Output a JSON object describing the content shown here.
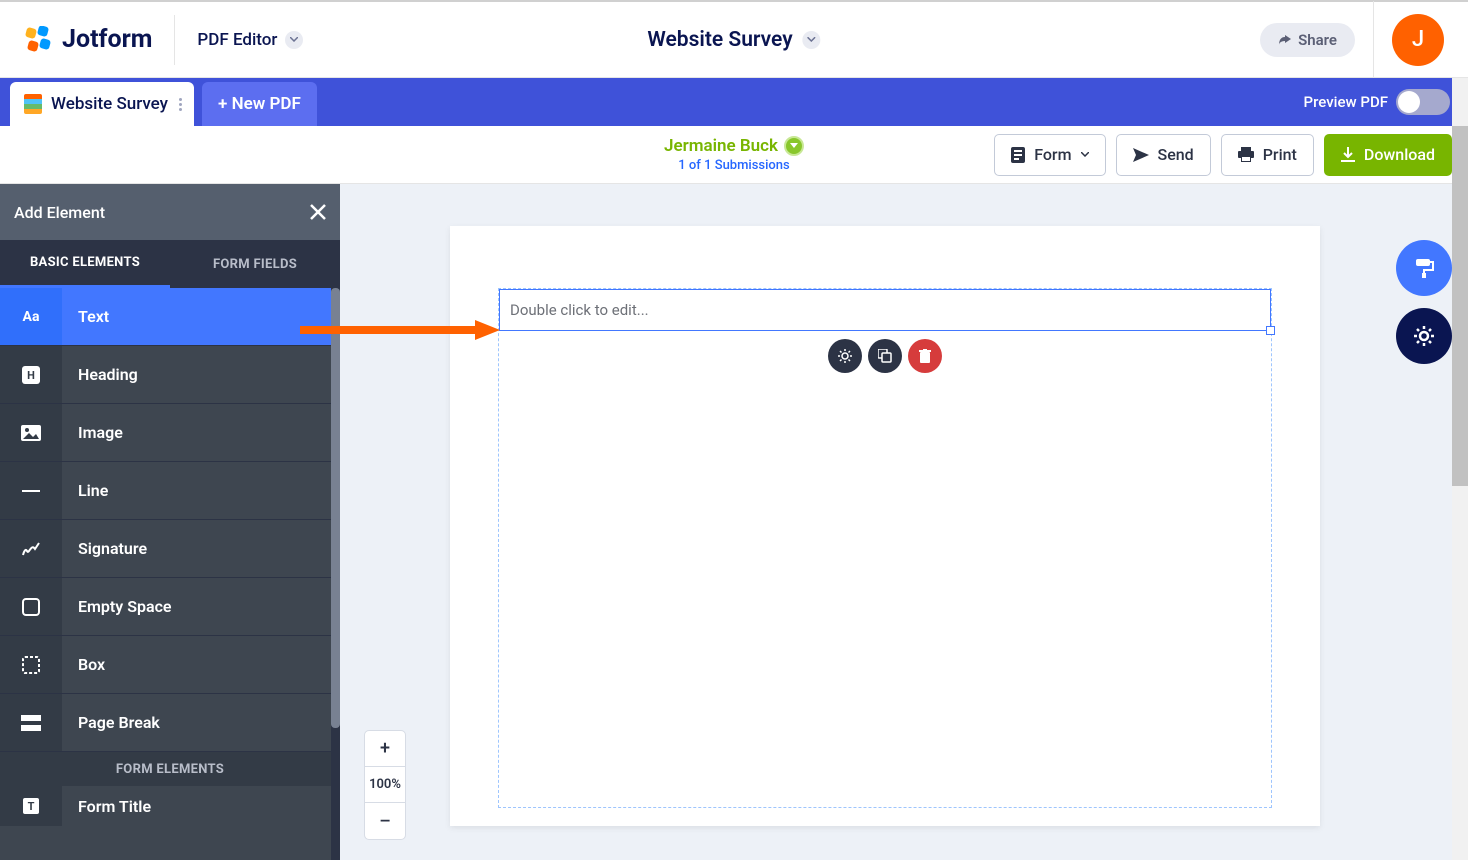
{
  "header": {
    "brand": "Jotform",
    "editor_label": "PDF Editor",
    "title": "Website Survey",
    "share": "Share",
    "avatar_initial": "J"
  },
  "tabbar": {
    "tab_label": "Website Survey",
    "new_pdf": "+ New PDF",
    "preview_label": "Preview PDF"
  },
  "toolbar": {
    "submitter": "Jermaine Buck",
    "sub_count": "1 of 1 Submissions",
    "form": "Form",
    "send": "Send",
    "print": "Print",
    "download": "Download"
  },
  "sidebar": {
    "title": "Add Element",
    "tabs": {
      "basic": "BASIC ELEMENTS",
      "form": "FORM FIELDS"
    },
    "items": [
      {
        "label": "Text"
      },
      {
        "label": "Heading"
      },
      {
        "label": "Image"
      },
      {
        "label": "Line"
      },
      {
        "label": "Signature"
      },
      {
        "label": "Empty Space"
      },
      {
        "label": "Box"
      },
      {
        "label": "Page Break"
      }
    ],
    "section_header": "FORM ELEMENTS",
    "truncated_item": "Form Title"
  },
  "canvas": {
    "placeholder": "Double click to edit..."
  },
  "zoom": {
    "level": "100%"
  }
}
